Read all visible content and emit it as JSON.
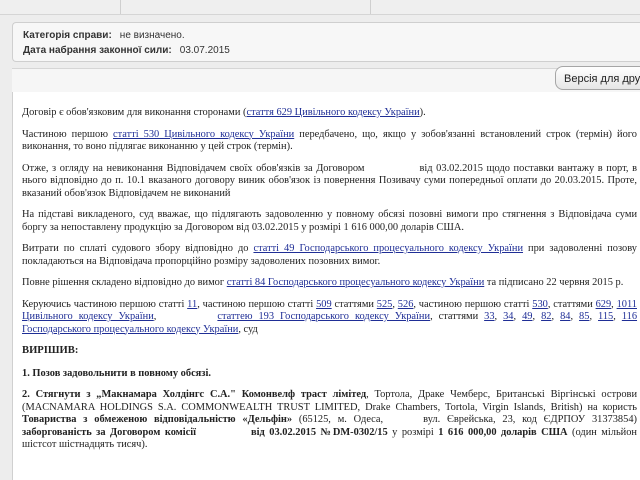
{
  "meta": {
    "category_label": "Категорія справи:",
    "category_value": "не визначено.",
    "date_label": "Дата набрання законної сили:",
    "date_value": "03.07.2015"
  },
  "toolbar": {
    "print_button": "Версія для друку"
  },
  "document": {
    "p1": {
      "t1": "Договір є обов'язковим для виконання сторонами (",
      "link": "стаття 629 Цивільного кодексу України",
      "t2": ")."
    },
    "p2": {
      "t1": "Частиною першою ",
      "link": "статті 530 Цивільного кодексу України",
      "t2": " передбачено, що, якщо у зобов'язанні встановлений строк (термін) його виконання, то воно підлягає виконанню у цей строк (термін)."
    },
    "p3": {
      "t1": "Отже, з огляду на невиконання Відповідачем своїх обов'язків за Договором",
      "t2": "від 03.02.2015 щодо поставки вантажу в порт, в нього відповідно до п. 10.1 вказаного договору виник обов'язок із повернення Позивачу суми попередньої оплати до 20.03.2015. Проте, вказаний обов'язок Відповідачем не виконаний"
    },
    "p4": "На підставі викладеного, суд вважає, що підлягають задоволенню у повному обсязі позовні вимоги про стягнення з Відповідача суми боргу за непоставлену продукцію за Договором від 03.02.2015 у розмірі 1 616 000,00 доларів США.",
    "p5": {
      "t1": "Витрати по сплаті судового збору відповідно до ",
      "link": "статті 49 Господарського процесуального кодексу України",
      "t2": " при задоволенні позову покладаються на Відповідача пропорційно розміру задоволених позовних вимог."
    },
    "p6": {
      "t1": "Повне рішення складено відповідно до вимог ",
      "link": "статті 84 Господарського процесуального кодексу України",
      "t2": " та підписано 22 червня 2015 р."
    },
    "p7": {
      "t1": "Керуючись  частиною першою статті ",
      "l1": "11",
      "t2": ", частиною першою статті ",
      "l2": "509",
      "t3": " статтями ",
      "l3": "525",
      "t4": ", ",
      "l4": "526",
      "t5": ", частиною першою статті ",
      "l5": "530",
      "t6": ", статтями ",
      "l6": "629",
      "t7": ", ",
      "l7": "1011 Цивільного кодексу України",
      "t8": ", ",
      "t9": "статтею 193 Господарського кодексу України",
      "t10": ", статтями ",
      "l8": "33",
      "t11": ", ",
      "l9": "34",
      "l10": "49",
      "l11": "82",
      "l12": "84",
      "l13": "85",
      "l14": "115",
      "l15": "116 Господарського процесуального кодексу України",
      "t12": ", суд"
    },
    "heading": "ВИРІШИВ:",
    "item1": "1. Позов задовольнити в повному обсязі.",
    "item2": {
      "t1": "2. Стягнути з „Макнамара Холдінгс С.А.\" Комонвелф траст лімітед",
      "t2": ", Тортола, Драке Чемберс, Британські Віргінські острови (MACNAMARA HOLDINGS S.A. COMMONWEALTH TRUST LIMITED, Drake Chambers, Tortola, Virgin Islands, British) на користь ",
      "t3": "Товариства з обмеженою відповідальністю «Дельфін»",
      "t4": " (65125, м. Одеса,",
      "t5": "вул. Єврейська, 23, код ЄДРПОУ 31373854) ",
      "t6": "заборгованість за Договором комісії",
      "t7": "від 03.02.2015 №DM-0302/15",
      "t8": " у розмірі ",
      "t9": "1 616 000,00 доларів США",
      "t10": " (один мільйон шістсот шістнадцять тисяч)."
    }
  }
}
